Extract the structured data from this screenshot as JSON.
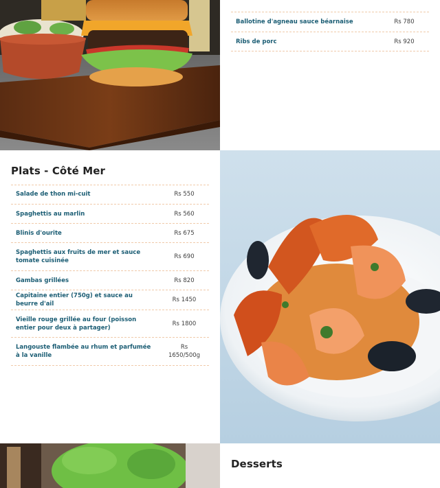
{
  "top_right_menu": {
    "items": [
      {
        "name": "Ballotine d'agneau sauce béarnaise",
        "price": "Rs 780"
      },
      {
        "name": "Ribs de porc",
        "price": "Rs 920"
      }
    ]
  },
  "sea_section": {
    "title": "Plats - Côté Mer",
    "items": [
      {
        "name": "Salade de thon mi-cuit",
        "price": "Rs 550"
      },
      {
        "name": "Spaghettis au marlin",
        "price": "Rs 560"
      },
      {
        "name": "Blinis d'ourite",
        "price": "Rs 675"
      },
      {
        "name": "Spaghettis aux fruits de mer et sauce tomate cuisinée",
        "price": "Rs 690"
      },
      {
        "name": "Gambas grillées",
        "price": "Rs 820"
      },
      {
        "name": "Capitaine entier (750g) et sauce au beurre d'ail",
        "price": "Rs 1450"
      },
      {
        "name": "Vieille rouge grillée au four (poisson entier pour deux à partager)",
        "price": "Rs 1800"
      },
      {
        "name": "Langouste flambée au rhum et parfumée à la vanille",
        "price": "Rs 1650/500g"
      }
    ]
  },
  "desserts_section": {
    "title": "Desserts"
  },
  "colors": {
    "item_name": "#1b5d74",
    "divider": "#f0c9a8",
    "title": "#222222"
  }
}
